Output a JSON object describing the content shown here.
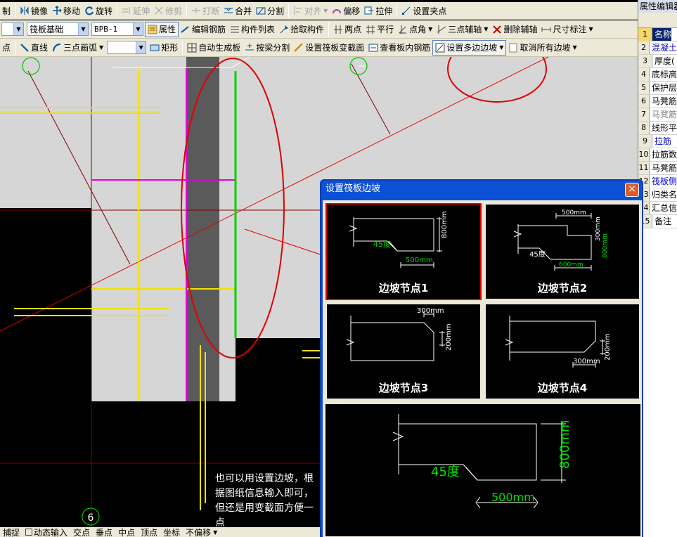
{
  "toolbar1": {
    "items": [
      {
        "label": "制",
        "icon": "partial-icon",
        "enabled": true
      },
      {
        "label": "镜像",
        "icon": "mirror-icon",
        "enabled": true
      },
      {
        "label": "移动",
        "icon": "move-icon",
        "enabled": true
      },
      {
        "label": "旋转",
        "icon": "rotate-icon",
        "enabled": true
      },
      {
        "label": "延伸",
        "icon": "extend-icon",
        "enabled": false
      },
      {
        "label": "修剪",
        "icon": "trim-icon",
        "enabled": false
      },
      {
        "label": "打断",
        "icon": "break-icon",
        "enabled": false
      },
      {
        "label": "合并",
        "icon": "merge-icon",
        "enabled": true
      },
      {
        "label": "分割",
        "icon": "split-icon",
        "enabled": true
      },
      {
        "label": "对齐",
        "icon": "align-icon",
        "enabled": false
      },
      {
        "label": "偏移",
        "icon": "offset-icon",
        "enabled": true
      },
      {
        "label": "拉伸",
        "icon": "stretch-icon",
        "enabled": true
      },
      {
        "label": "设置夹点",
        "icon": "grip-icon",
        "enabled": true
      }
    ]
  },
  "toolbar2": {
    "combo_type": "筏板基础",
    "combo_name": "BPB-1",
    "items": [
      "属性",
      "编辑钢筋",
      "构件列表",
      "拾取构件",
      "两点",
      "平行",
      "点角",
      "三点辅轴",
      "删除辅轴",
      "尺寸标注"
    ]
  },
  "toolbar3": {
    "items": [
      "点",
      "直线",
      "三点画弧",
      "矩形",
      "自动生成板",
      "按梁分割",
      "设置筏板变截面",
      "查看板内钢筋",
      "设置多边边坡",
      "取消所有边坡"
    ]
  },
  "canvas": {
    "axis_label": "6",
    "annotation": "也可以用设置边坡，根据图纸信息输入即可，但还是用变截面方便一点"
  },
  "statusbar": {
    "items": [
      "捕捉",
      "动态输入",
      "交点",
      "垂点",
      "中点",
      "顶点",
      "坐标",
      "不偏移"
    ]
  },
  "property_panel": {
    "title": "属性编辑器",
    "rows": [
      {
        "num": "1",
        "label": "名称",
        "style": "sel"
      },
      {
        "num": "2",
        "label": "混凝土",
        "style": "blue"
      },
      {
        "num": "3",
        "label": "厚度(",
        "style": ""
      },
      {
        "num": "4",
        "label": "底标高",
        "style": ""
      },
      {
        "num": "5",
        "label": "保护层",
        "style": ""
      },
      {
        "num": "6",
        "label": "马凳筋",
        "style": ""
      },
      {
        "num": "7",
        "label": "马凳筋",
        "style": "gray"
      },
      {
        "num": "8",
        "label": "线形平",
        "style": ""
      },
      {
        "num": "9",
        "label": "拉筋",
        "style": "blue"
      },
      {
        "num": "10",
        "label": "拉筋数",
        "style": ""
      },
      {
        "num": "11",
        "label": "马凳筋",
        "style": ""
      },
      {
        "num": "12",
        "label": "筏板侧",
        "style": "blue"
      },
      {
        "num": "13",
        "label": "归类名",
        "style": ""
      },
      {
        "num": "14",
        "label": "汇总信",
        "style": ""
      },
      {
        "num": "15",
        "label": "备注",
        "style": ""
      }
    ]
  },
  "dialog": {
    "title": "设置筏板边坡",
    "close": "×",
    "nodes": [
      {
        "caption": "边坡节点1",
        "dims": [
          "45度",
          "500mm",
          "800mm"
        ]
      },
      {
        "caption": "边坡节点2",
        "dims": [
          "500mm",
          "45度",
          "600mm",
          "300mm",
          "800mm"
        ]
      },
      {
        "caption": "边坡节点3",
        "dims": [
          "300mm",
          "200mm"
        ]
      },
      {
        "caption": "边坡节点4",
        "dims": [
          "300mm",
          "200mm"
        ]
      }
    ],
    "preview": {
      "angle": "45度",
      "width": "500mm",
      "height": "800mm"
    }
  }
}
